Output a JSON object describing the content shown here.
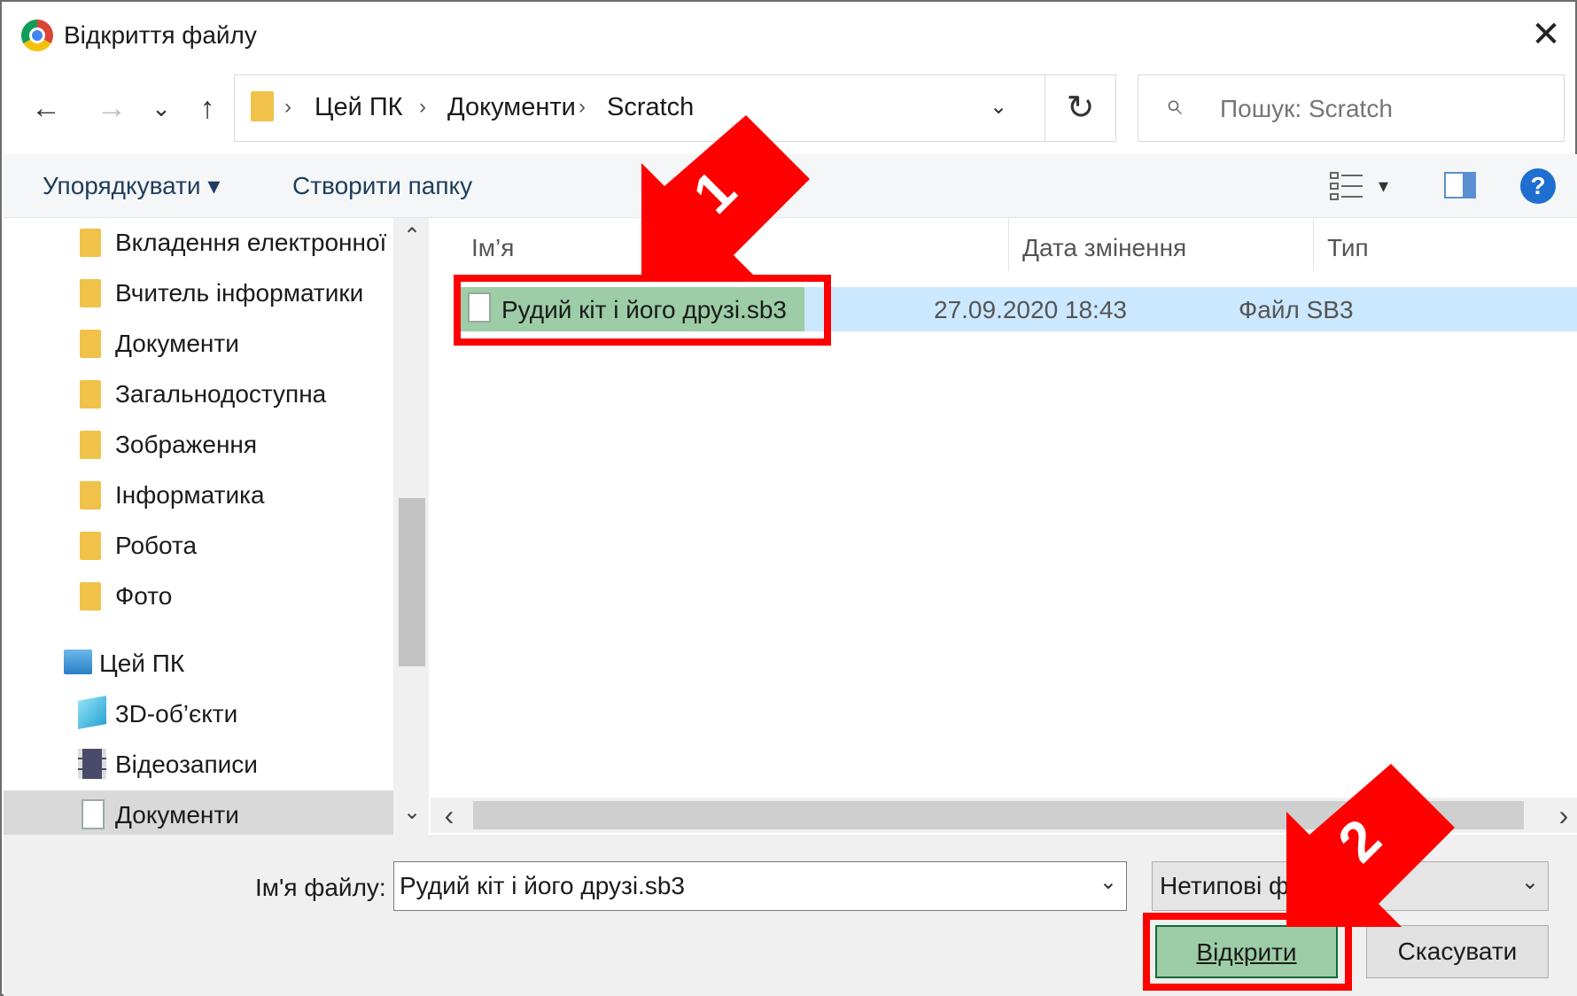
{
  "window": {
    "title": "Відкриття файлу",
    "close_symbol": "✕"
  },
  "nav": {
    "back": "←",
    "forward": "→",
    "recent": "⌄",
    "up": "↑",
    "refresh": "↻"
  },
  "address": {
    "crumbs": [
      "Цей ПК",
      "Документи",
      "Scratch"
    ],
    "separator": "›",
    "dropdown": "⌄"
  },
  "search": {
    "placeholder": "Пошук: Scratch",
    "icon": "⌕"
  },
  "toolbar": {
    "organize": "Упорядкувати ▾",
    "new_folder": "Створити папку",
    "view_dropdown": "▾",
    "help": "?"
  },
  "sidebar": {
    "items": [
      {
        "label": "Вкладення електронної",
        "icon": "folder-icon"
      },
      {
        "label": "Вчитель інформатики",
        "icon": "folder-icon"
      },
      {
        "label": "Документи",
        "icon": "folder-icon"
      },
      {
        "label": "Загальнодоступна",
        "icon": "folder-icon"
      },
      {
        "label": "Зображення",
        "icon": "folder-icon"
      },
      {
        "label": "Інформатика",
        "icon": "folder-icon"
      },
      {
        "label": "Робота",
        "icon": "folder-icon"
      },
      {
        "label": "Фото",
        "icon": "folder-icon"
      },
      {
        "label": "Цей ПК",
        "icon": "computer-icon"
      },
      {
        "label": "3D-об’єкти",
        "icon": "cube-icon"
      },
      {
        "label": "Відеозаписи",
        "icon": "film-icon"
      },
      {
        "label": "Документи",
        "icon": "document-icon"
      }
    ],
    "scroll_up": "⌃",
    "scroll_down": "⌄"
  },
  "file_list": {
    "columns": {
      "name": "Ім’я",
      "date": "Дата змінення",
      "type": "Тип"
    },
    "rows": [
      {
        "name": "Рудий кіт і його друзі.sb3",
        "date": "27.09.2020 18:43",
        "type": "Файл SB3"
      }
    ],
    "scroll_left": "‹",
    "scroll_right": "›"
  },
  "bottom": {
    "filename_label": "Ім'я файлу:",
    "filename_value": "Рудий кіт і його друзі.sb3",
    "filetype_value": "Нетипові файли",
    "open_label": "Відкрити",
    "cancel_label": "Скасувати"
  },
  "annotations": {
    "step1": "1",
    "step2": "2",
    "color": "#ff0000"
  }
}
